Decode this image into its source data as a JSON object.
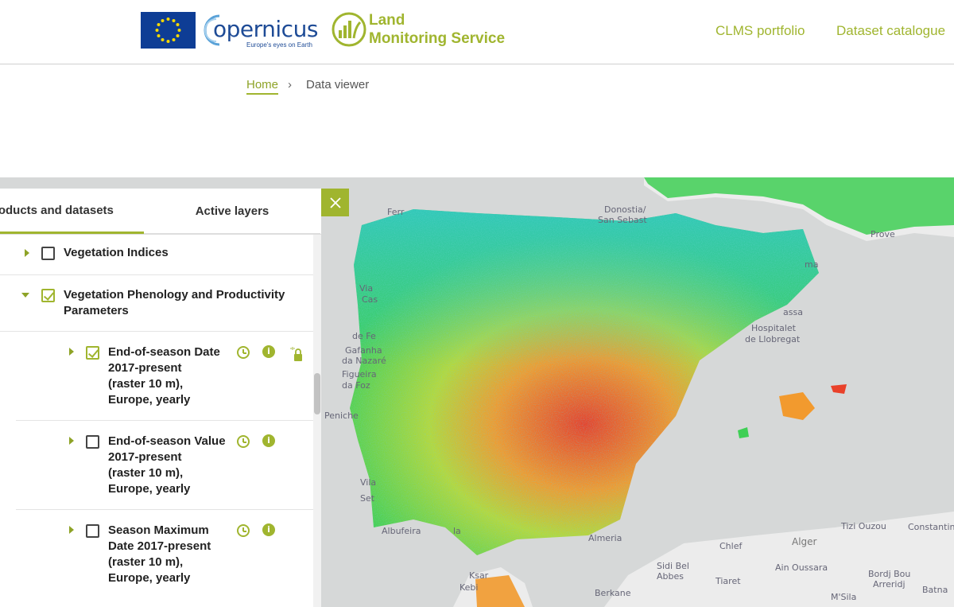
{
  "header": {
    "copernicus_wordmark": "opernicus",
    "copernicus_tagline": "Europe's eyes on Earth",
    "lms_line1": "Land",
    "lms_line2": "Monitoring Service",
    "nav": [
      "CLMS portfolio",
      "Dataset catalogue"
    ]
  },
  "breadcrumb": {
    "home": "Home",
    "separator": "›",
    "current": "Data viewer"
  },
  "panel": {
    "tabs": [
      "roducts and datasets",
      "Active layers"
    ],
    "close": "✕",
    "items": [
      {
        "label": "Vegetation Indices",
        "checked": false,
        "expanded": false
      },
      {
        "label": "Vegetation Phenology and Productivity Parameters",
        "checked": true,
        "expanded": true
      },
      {
        "label_lines": [
          "End-of-season Date",
          "2017-present",
          "(raster 10 m),",
          "Europe, yearly"
        ],
        "checked": true
      },
      {
        "label_lines": [
          "End-of-season Value",
          "2017-present",
          "(raster 10 m),",
          "Europe, yearly"
        ],
        "checked": false
      },
      {
        "label_lines": [
          "Season Maximum",
          "Date 2017-present",
          "(raster 10 m),",
          "Europe, yearly"
        ],
        "checked": false
      }
    ],
    "icon_names": [
      "clock-icon",
      "info-icon",
      "lock-icon"
    ]
  },
  "map": {
    "labels": [
      "Ferr",
      "Donostia/",
      "San Sebast",
      "Prove",
      "Via",
      "Cas",
      "de Fe",
      "Gafanha",
      "da Nazaré",
      "Figueira",
      "da Foz",
      "Peniche",
      "Vila",
      "Set",
      "Albufeira",
      "la",
      "Ksar",
      "Kebi",
      "Hospitalet",
      "de Llobregat",
      "assa",
      "ma",
      "Almeria",
      "Tizi Ouzou",
      "Alger",
      "Constantine",
      "Chlef",
      "Sidi Bel",
      "Abbes",
      "Tiaret",
      "Ain Oussara",
      "Bordj Bou",
      "Arreridj",
      "Batna",
      "M'Sila",
      "Berkane"
    ],
    "colors": {
      "sea": "#d6d8d8",
      "land": "#ececec",
      "data_green": "#3fcf55",
      "data_orange": "#f29a2e",
      "data_red": "#e9412a",
      "data_cyan": "#2fc7c9"
    }
  }
}
